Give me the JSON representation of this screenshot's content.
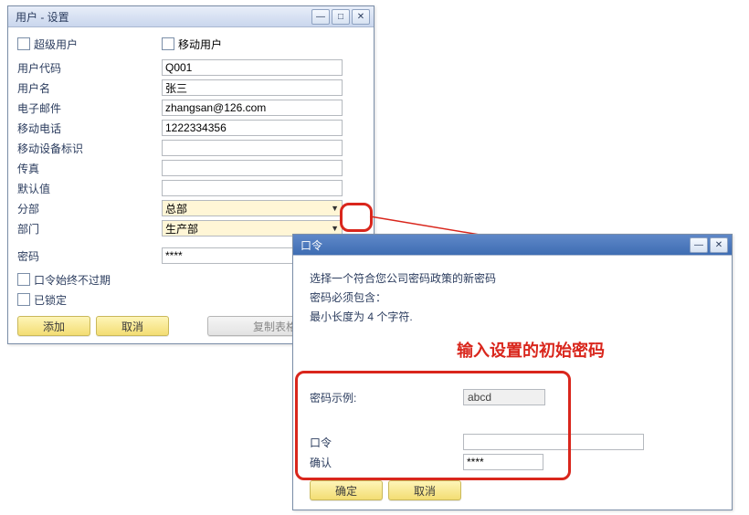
{
  "userDialog": {
    "title": "用户 - 设置",
    "superUserLabel": "超级用户",
    "mobileUserLabel": "移动用户",
    "fields": {
      "userCode": {
        "label": "用户代码",
        "value": "Q001"
      },
      "userName": {
        "label": "用户名",
        "value": "张三"
      },
      "email": {
        "label": "电子邮件",
        "value": "zhangsan@126.com"
      },
      "mobilePhone": {
        "label": "移动电话",
        "value": "1222334356"
      },
      "mobileDevice": {
        "label": "移动设备标识",
        "value": ""
      },
      "fax": {
        "label": "传真",
        "value": ""
      },
      "defaults": {
        "label": "默认值",
        "value": ""
      },
      "branch": {
        "label": "分部",
        "value": "总部"
      },
      "dept": {
        "label": "部门",
        "value": "生产部"
      },
      "password": {
        "label": "密码",
        "value": "****"
      },
      "neverExpire": {
        "label": "口令始终不过期"
      },
      "locked": {
        "label": "已锁定"
      }
    },
    "buttons": {
      "add": "添加",
      "cancel": "取消",
      "copyTableSettings": "复制表格设置"
    }
  },
  "passwordDialog": {
    "title": "口令",
    "instructions": {
      "line1": "选择一个符合您公司密码政策的新密码",
      "line2": "密码必须包含：",
      "line3": "最小长度为 4 个字符."
    },
    "exampleLabel": "密码示例:",
    "exampleValue": "abcd",
    "passwordLabel": "口令",
    "passwordValue": "",
    "confirmLabel": "确认",
    "confirmValue": "****",
    "buttons": {
      "ok": "确定",
      "cancel": "取消"
    }
  },
  "annotation": "输入设置的初始密码",
  "icons": {
    "dots": "..."
  }
}
